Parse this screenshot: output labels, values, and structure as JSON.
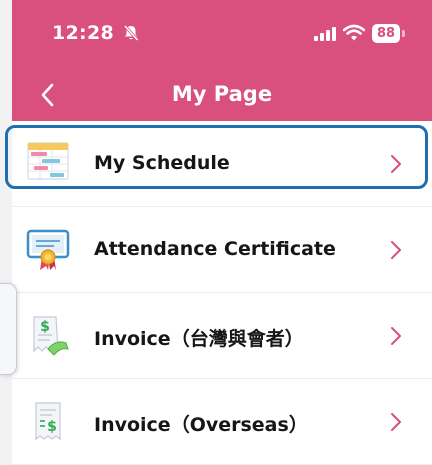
{
  "status_bar": {
    "time": "12:28",
    "battery_level": "88",
    "icons": [
      "bell-slash-icon",
      "signal-icon",
      "wifi-icon",
      "battery-icon"
    ]
  },
  "nav": {
    "title": "My Page",
    "back_icon": "chevron-left-icon"
  },
  "menu": {
    "items": [
      {
        "label": "My Schedule",
        "icon": "schedule-icon",
        "selected": true
      },
      {
        "label": "Attendance Certificate",
        "icon": "certificate-icon",
        "selected": false
      },
      {
        "label": "Invoice（台灣與會者）",
        "icon": "invoice-receipt-icon",
        "selected": false
      },
      {
        "label": "Invoice（Overseas）",
        "icon": "invoice-document-icon",
        "selected": false
      }
    ]
  },
  "colors": {
    "header": "#d94f7e",
    "highlight": "#1f6fb0",
    "chevron": "#d94f7e",
    "text": "#161616"
  }
}
